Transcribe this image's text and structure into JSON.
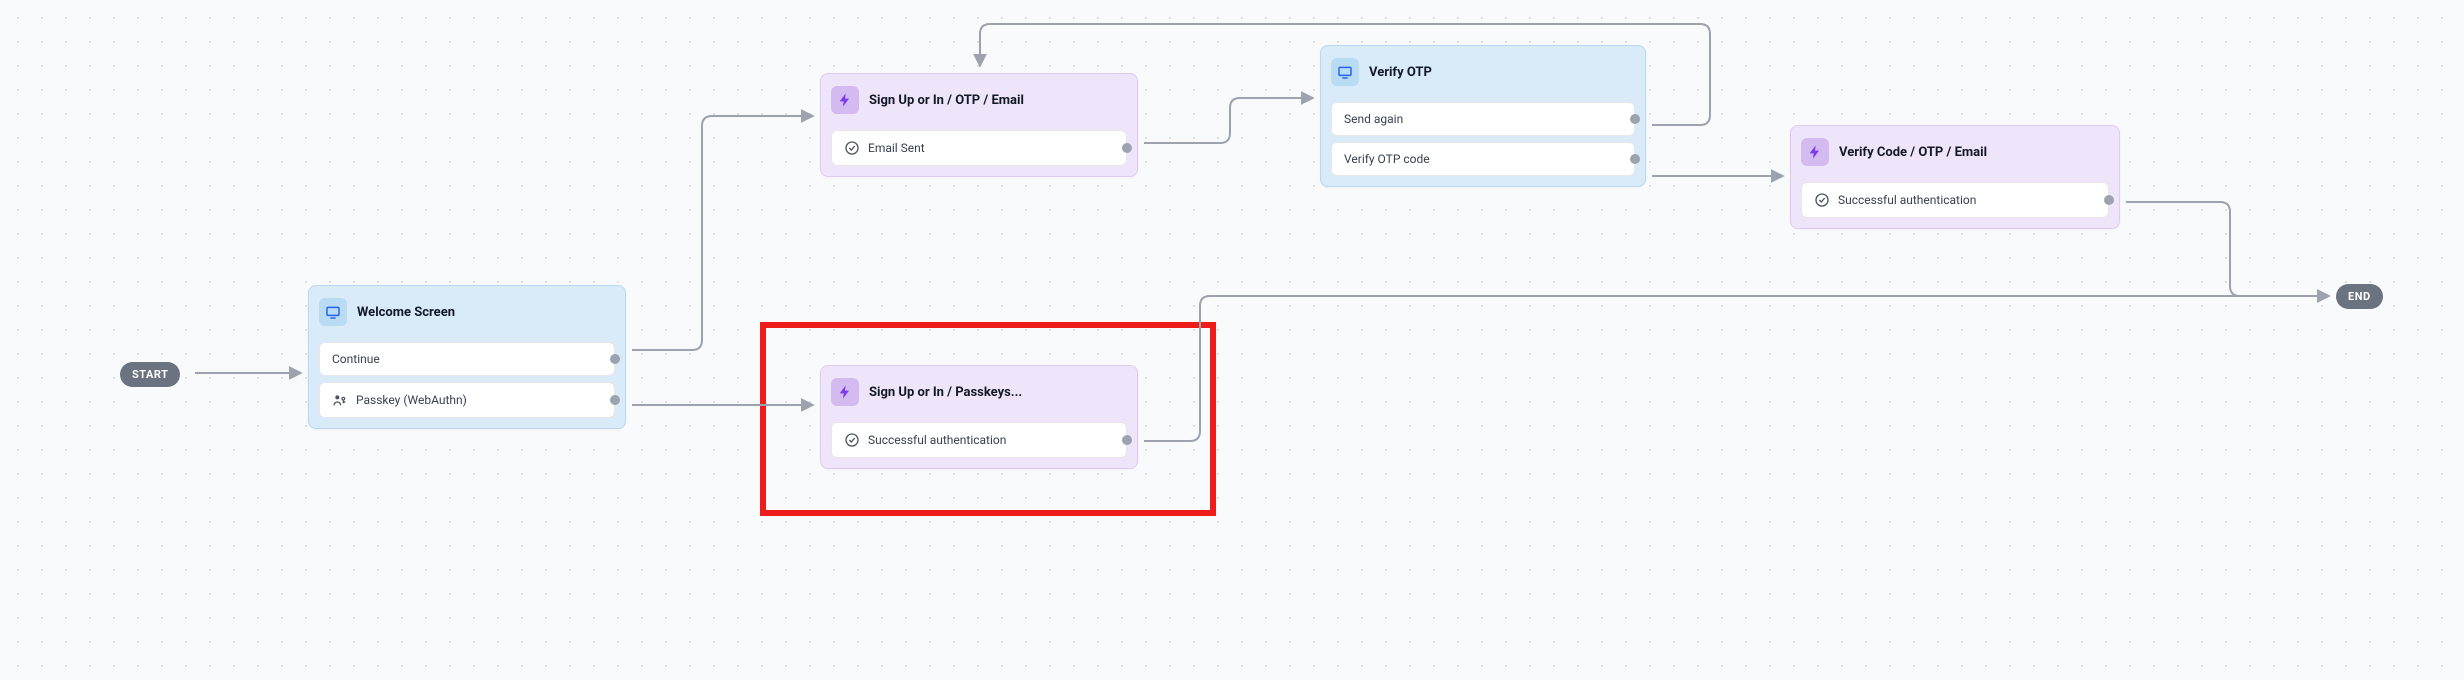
{
  "diagram": {
    "start_label": "START",
    "end_label": "END",
    "nodes": {
      "welcome": {
        "title": "Welcome Screen",
        "icon": "screen",
        "rows": [
          {
            "label": "Continue",
            "icon": null
          },
          {
            "label": "Passkey (WebAuthn)",
            "icon": "passkey"
          }
        ]
      },
      "signup_otp": {
        "title": "Sign Up or In / OTP / Email",
        "icon": "bolt",
        "rows": [
          {
            "label": "Email Sent",
            "icon": "check"
          }
        ]
      },
      "verify_otp": {
        "title": "Verify OTP",
        "icon": "screen",
        "rows": [
          {
            "label": "Send again",
            "icon": null
          },
          {
            "label": "Verify OTP code",
            "icon": null
          }
        ]
      },
      "verify_code": {
        "title": "Verify Code / OTP / Email",
        "icon": "bolt",
        "rows": [
          {
            "label": "Successful authentication",
            "icon": "check"
          }
        ]
      },
      "signup_passkeys": {
        "title": "Sign Up or In / Passkeys...",
        "icon": "bolt",
        "rows": [
          {
            "label": "Successful authentication",
            "icon": "check"
          }
        ]
      }
    },
    "edges": [
      {
        "from": "start",
        "to": "welcome"
      },
      {
        "from": "welcome.continue",
        "to": "signup_otp"
      },
      {
        "from": "welcome.passkey",
        "to": "signup_passkeys"
      },
      {
        "from": "signup_otp.email_sent",
        "to": "verify_otp"
      },
      {
        "from": "verify_otp.send_again",
        "to": "signup_otp",
        "note": "loop back"
      },
      {
        "from": "verify_otp.verify_code",
        "to": "verify_code"
      },
      {
        "from": "verify_code.success",
        "to": "end"
      },
      {
        "from": "signup_passkeys.success",
        "to": "end"
      }
    ],
    "highlighted_node": "signup_passkeys"
  }
}
